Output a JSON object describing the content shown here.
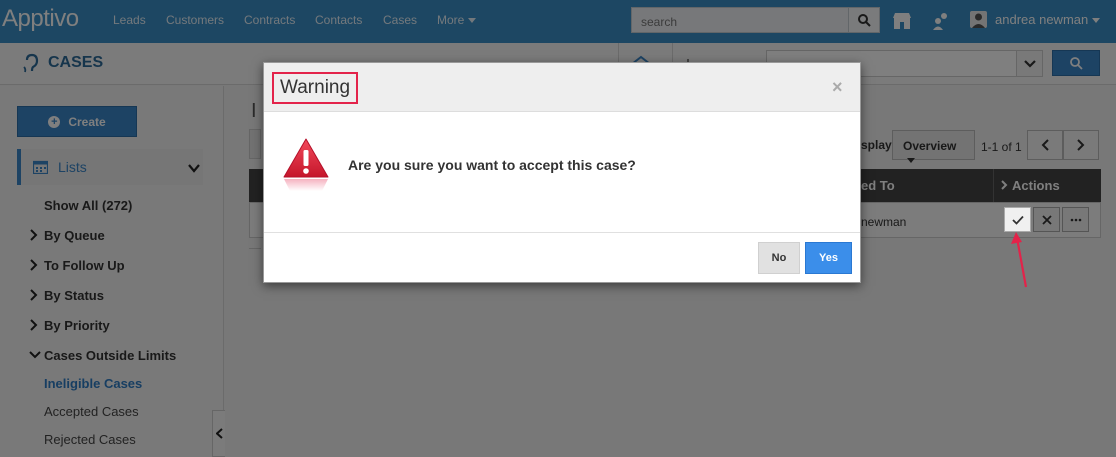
{
  "app": {
    "logo": "Apptivo",
    "nav": [
      "Leads",
      "Customers",
      "Contracts",
      "Contacts",
      "Cases",
      "More"
    ],
    "search_placeholder": "search",
    "user_name": "andrea newman"
  },
  "page": {
    "title": "CASES",
    "main_title_partial": "I"
  },
  "sidebar": {
    "create_label": "Create",
    "lists_label": "Lists",
    "items": [
      {
        "label": "Show All (272)"
      },
      {
        "label": "By Queue"
      },
      {
        "label": "To Follow Up"
      },
      {
        "label": "By Status"
      },
      {
        "label": "By Priority"
      },
      {
        "label": "Cases Outside Limits"
      },
      {
        "label": "Ineligible Cases"
      },
      {
        "label": "Accepted Cases"
      },
      {
        "label": "Rejected Cases"
      }
    ]
  },
  "toolbar": {
    "display_label": "splay",
    "display_value": "Overview",
    "pager_text": "1-1 of 1"
  },
  "table": {
    "col_assigned": "ed To",
    "col_actions": "Actions",
    "row_owner": "newman"
  },
  "modal": {
    "title": "Warning",
    "close": "×",
    "message": "Are you sure you want to accept this case?",
    "no_label": "No",
    "yes_label": "Yes"
  },
  "colors": {
    "nav_bg": "#3a8fc6",
    "accent": "#3b86c9",
    "warning_red": "#e3234a",
    "yes_blue": "#3b8eea"
  }
}
